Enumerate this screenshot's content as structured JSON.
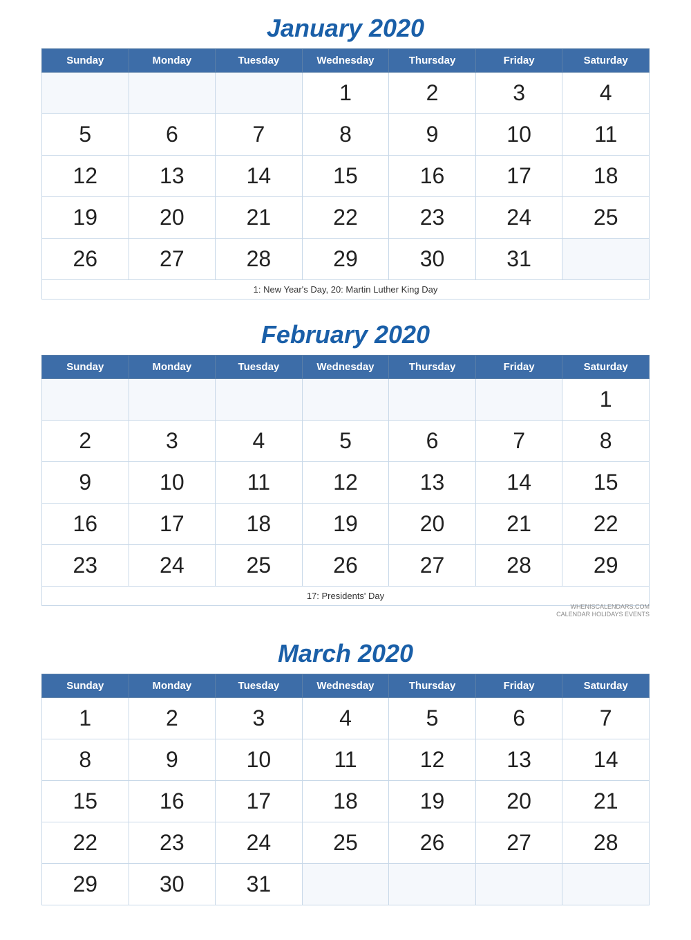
{
  "january": {
    "title": "January 2020",
    "headers": [
      "Sunday",
      "Monday",
      "Tuesday",
      "Wednesday",
      "Thursday",
      "Friday",
      "Saturday"
    ],
    "weeks": [
      [
        "",
        "",
        "",
        "1",
        "2",
        "3",
        "4"
      ],
      [
        "5",
        "6",
        "7",
        "8",
        "9",
        "10",
        "11"
      ],
      [
        "12",
        "13",
        "14",
        "15",
        "16",
        "17",
        "18"
      ],
      [
        "19",
        "20",
        "21",
        "22",
        "23",
        "24",
        "25"
      ],
      [
        "26",
        "27",
        "28",
        "29",
        "30",
        "31",
        ""
      ]
    ],
    "holidays": "1: New Year's Day, 20: Martin Luther King Day"
  },
  "february": {
    "title": "February 2020",
    "headers": [
      "Sunday",
      "Monday",
      "Tuesday",
      "Wednesday",
      "Thursday",
      "Friday",
      "Saturday"
    ],
    "weeks": [
      [
        "",
        "",
        "",
        "",
        "",
        "",
        "1"
      ],
      [
        "2",
        "3",
        "4",
        "5",
        "6",
        "7",
        "8"
      ],
      [
        "9",
        "10",
        "11",
        "12",
        "13",
        "14",
        "15"
      ],
      [
        "16",
        "17",
        "18",
        "19",
        "20",
        "21",
        "22"
      ],
      [
        "23",
        "24",
        "25",
        "26",
        "27",
        "28",
        "29"
      ]
    ],
    "holidays": "17: Presidents' Day"
  },
  "march": {
    "title": "March 2020",
    "headers": [
      "Sunday",
      "Monday",
      "Tuesday",
      "Wednesday",
      "Thursday",
      "Friday",
      "Saturday"
    ],
    "weeks": [
      [
        "1",
        "2",
        "3",
        "4",
        "5",
        "6",
        "7"
      ],
      [
        "8",
        "9",
        "10",
        "11",
        "12",
        "13",
        "14"
      ],
      [
        "15",
        "16",
        "17",
        "18",
        "19",
        "20",
        "21"
      ],
      [
        "22",
        "23",
        "24",
        "25",
        "26",
        "27",
        "28"
      ],
      [
        "29",
        "30",
        "31",
        "",
        "",
        "",
        ""
      ]
    ],
    "holidays": ""
  },
  "watermark": {
    "main": "WHENISCALENDARS.COM",
    "sub": "CALENDAR   HOLIDAYS   EVENTS"
  }
}
